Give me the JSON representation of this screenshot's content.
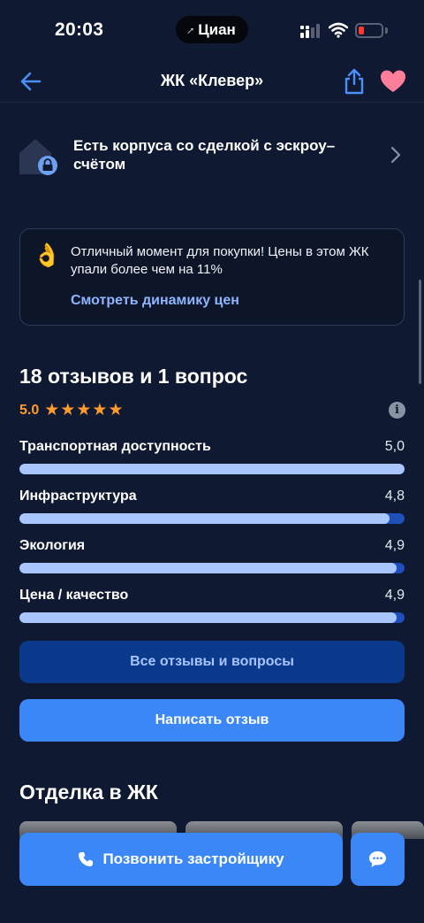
{
  "status_bar": {
    "time": "20:03",
    "app_badge": "Циан",
    "battery_color": "#ff3b30"
  },
  "nav": {
    "title": "ЖК «Клевер»",
    "back_icon": "arrow-left-icon",
    "share_icon": "share-icon",
    "favorite_icon": "heart-icon",
    "favorite_color": "#ff7f9a"
  },
  "escrow": {
    "text": "Есть корпуса со сделкой с эскроу–счётом",
    "icon": "house-lock-icon"
  },
  "price_card": {
    "icon": "👌",
    "text": "Отличный момент для покупки! Цены в этом ЖК упали более чем на 11%",
    "link": "Смотреть динамику цен"
  },
  "reviews": {
    "title": "18 отзывов и 1 вопрос",
    "rating": "5.0",
    "stars": 5,
    "accent": "#ff9a2e",
    "metrics": [
      {
        "label": "Транспортная доступность",
        "value": "5,0",
        "fraction": 1.0
      },
      {
        "label": "Инфраструктура",
        "value": "4,8",
        "fraction": 0.96
      },
      {
        "label": "Экология",
        "value": "4,9",
        "fraction": 0.98
      },
      {
        "label": "Цена / качество",
        "value": "4,9",
        "fraction": 0.98
      }
    ],
    "all_button": "Все отзывы и вопросы",
    "write_button": "Написать отзыв"
  },
  "finish": {
    "title": "Отделка в ЖК"
  },
  "bottom": {
    "call_button": "Позвонить застройщику",
    "chat_icon": "chat-icon"
  }
}
